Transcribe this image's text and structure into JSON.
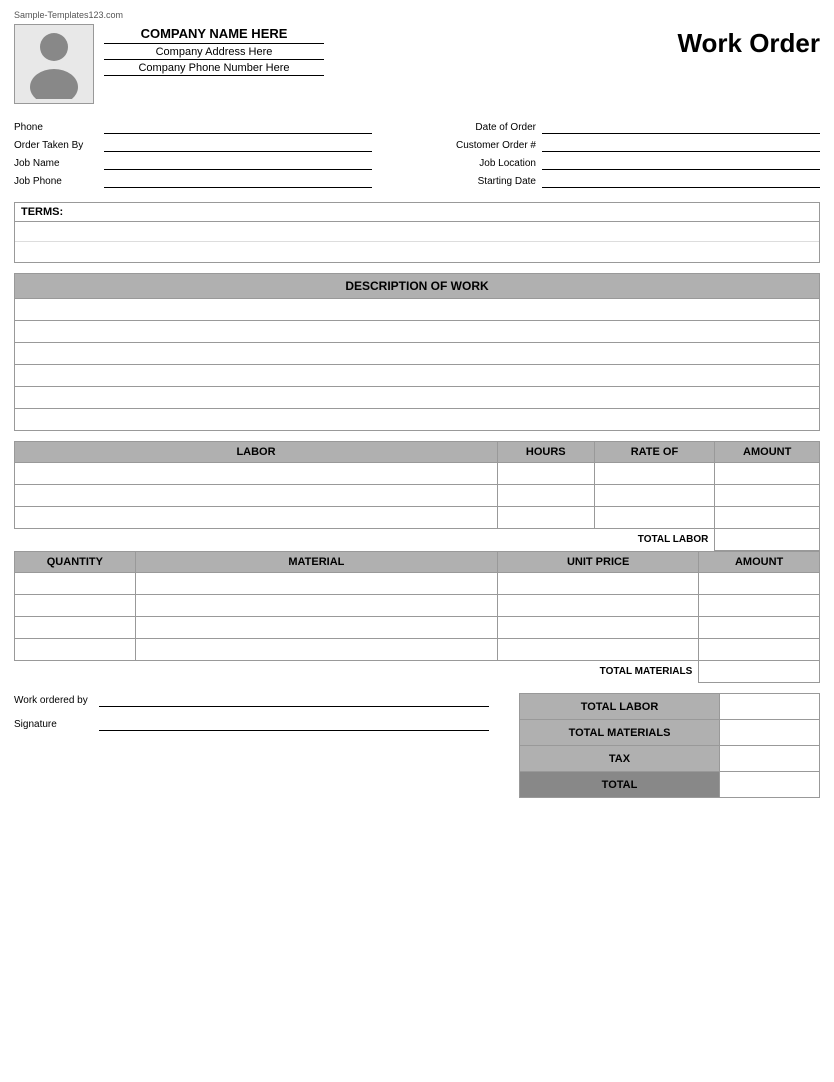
{
  "watermark": "Sample-Templates123.com",
  "header": {
    "company_name": "COMPANY NAME HERE",
    "company_address": "Company Address Here",
    "company_phone": "Company Phone Number Here",
    "title": "Work Order"
  },
  "form": {
    "phone_label": "Phone",
    "order_taken_by_label": "Order Taken By",
    "job_name_label": "Job Name",
    "job_phone_label": "Job Phone",
    "date_of_order_label": "Date of Order",
    "customer_order_label": "Customer Order #",
    "job_location_label": "Job Location",
    "starting_date_label": "Starting Date"
  },
  "terms": {
    "label": "TERMS:"
  },
  "desc_of_work": {
    "header": "DESCRIPTION OF WORK"
  },
  "labor": {
    "col1": "LABOR",
    "col2": "HOURS",
    "col3": "RATE OF",
    "col4": "AMOUNT",
    "total_label": "TOTAL LABOR"
  },
  "materials": {
    "col1": "QUANTITY",
    "col2": "MATERIAL",
    "col3": "UNIT PRICE",
    "col4": "AMOUNT",
    "total_label": "TOTAL MATERIALS"
  },
  "summary": {
    "work_ordered_label": "Work ordered by",
    "signature_label": "Signature",
    "total_labor": "TOTAL LABOR",
    "total_materials": "TOTAL MATERIALS",
    "tax": "TAX",
    "total": "TOTAL"
  }
}
